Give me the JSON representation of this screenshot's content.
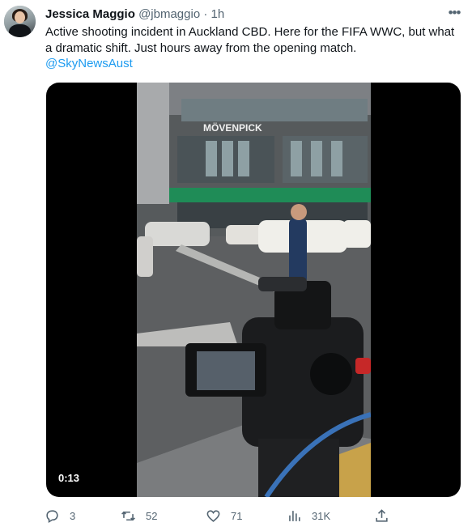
{
  "tweet": {
    "display_name": "Jessica Maggio",
    "handle": "@jbmaggio",
    "separator": "·",
    "time": "1h",
    "more_icon": "ellipsis-icon",
    "text": "Active shooting incident in Auckland CBD. Here for the FIFA WWC, but what a dramatic shift. Just hours away from the opening match.",
    "mention": "@SkyNewsAust"
  },
  "media": {
    "type": "video",
    "duration": "0:13",
    "sign_text": "MÖVENPICK"
  },
  "actions": {
    "replies": "3",
    "retweets": "52",
    "likes": "71",
    "views": "31K",
    "icons": [
      "reply-icon",
      "retweet-icon",
      "like-icon",
      "views-icon",
      "share-icon"
    ]
  },
  "colors": {
    "link": "#1d9bf0",
    "text": "#0f1419",
    "muted": "#536471"
  }
}
